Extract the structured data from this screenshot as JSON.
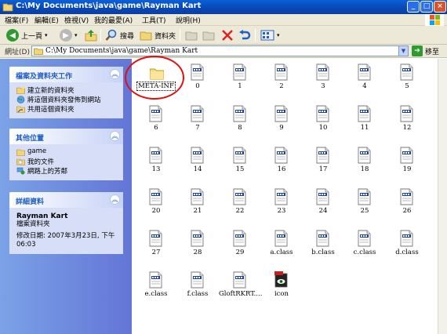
{
  "window": {
    "title": "C:\\My Documents\\java\\game\\Rayman Kart",
    "buttons": {
      "minimize": "_",
      "maximize": "□",
      "close": "×"
    }
  },
  "menu": [
    "檔案(F)",
    "編輯(E)",
    "檢視(V)",
    "我的最愛(A)",
    "工具(T)",
    "說明(H)"
  ],
  "toolbar": {
    "back": "上一頁",
    "search": "搜尋",
    "folders": "資料夾"
  },
  "address": {
    "label": "網址(D)",
    "value": "C:\\My Documents\\java\\game\\Rayman Kart",
    "go": "移至"
  },
  "tasks": {
    "title": "檔案及資料夾工作",
    "items": [
      "建立新的資料夾",
      "將這個資料夾發佈到網站",
      "共用這個資料夾"
    ]
  },
  "places": {
    "title": "其他位置",
    "items": [
      "game",
      "我的文件",
      "網路上的芳鄰"
    ]
  },
  "details": {
    "title": "詳細資料",
    "name": "Rayman Kart",
    "type": "檔案資料夾",
    "modified_1": "修改日期: 2007年3月23日, 下午",
    "modified_2": "06:03"
  },
  "files": [
    "META-INF",
    "0",
    "1",
    "2",
    "3",
    "4",
    "5",
    "6",
    "7",
    "8",
    "9",
    "10",
    "11",
    "12",
    "13",
    "14",
    "15",
    "16",
    "17",
    "18",
    "19",
    "20",
    "21",
    "22",
    "23",
    "24",
    "25",
    "26",
    "27",
    "28",
    "29",
    "a.class",
    "b.class",
    "c.class",
    "d.class",
    "e.class",
    "f.class",
    "GloftRKRT....",
    "icon"
  ],
  "colors": {
    "titlebar": "#0a5fd8",
    "sidepanel": "#7ba2e7",
    "highlight_circle": "#e01010"
  }
}
